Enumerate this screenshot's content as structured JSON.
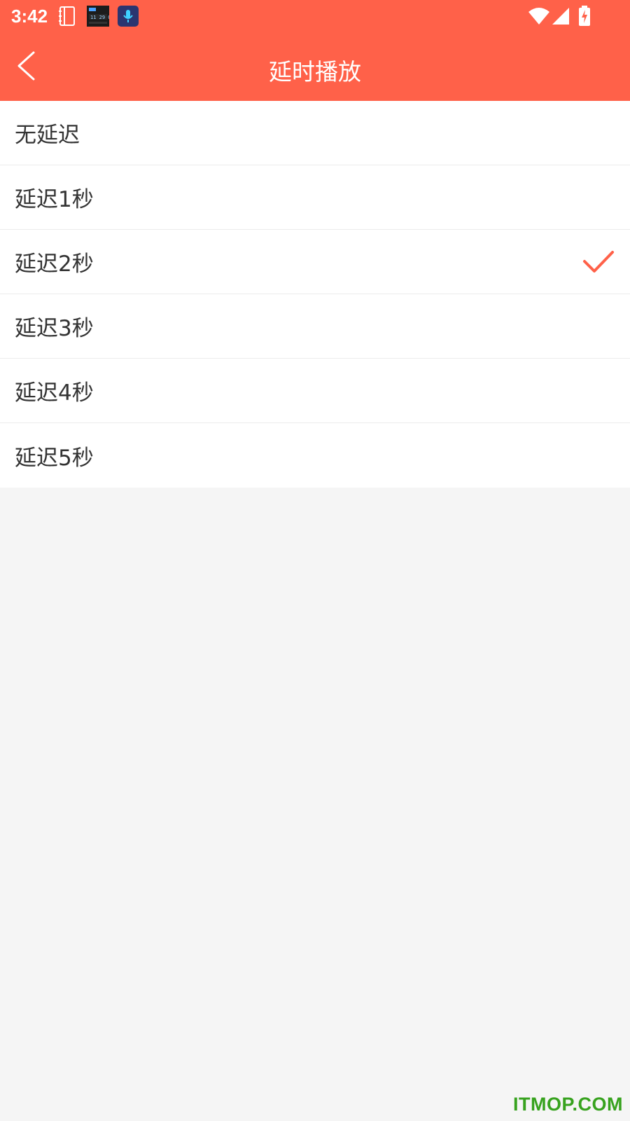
{
  "status_bar": {
    "time": "3:42",
    "icons": [
      "notebook-icon",
      "clock-widget-icon",
      "voice-app-icon",
      "wifi-icon",
      "signal-icon",
      "battery-charging-icon"
    ]
  },
  "app_bar": {
    "back_icon": "chevron-left-icon",
    "title": "延时播放"
  },
  "options": [
    {
      "label": "无延迟",
      "selected": false
    },
    {
      "label": "延迟1秒",
      "selected": false
    },
    {
      "label": "延迟2秒",
      "selected": true
    },
    {
      "label": "延迟3秒",
      "selected": false
    },
    {
      "label": "延迟4秒",
      "selected": false
    },
    {
      "label": "延迟5秒",
      "selected": false
    }
  ],
  "colors": {
    "accent": "#ff6149",
    "check": "#ff6149",
    "text": "#333333",
    "background": "#f5f5f5"
  },
  "watermark": "ITMOP.COM"
}
